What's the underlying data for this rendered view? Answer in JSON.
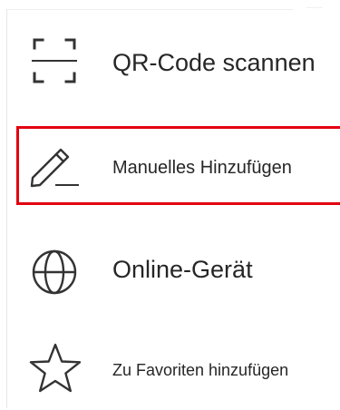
{
  "menu": {
    "items": [
      {
        "label": "QR-Code scannen",
        "icon": "scan-frame-icon"
      },
      {
        "label": "Manuelles Hinzufügen",
        "icon": "pencil-icon",
        "highlighted": true
      },
      {
        "label": "Online-Gerät",
        "icon": "globe-icon"
      },
      {
        "label": "Zu Favoriten hinzufügen",
        "icon": "star-icon"
      }
    ]
  },
  "colors": {
    "highlight_border": "#e3000f",
    "text": "#262626",
    "icon": "#333333",
    "background": "#ffffff"
  }
}
